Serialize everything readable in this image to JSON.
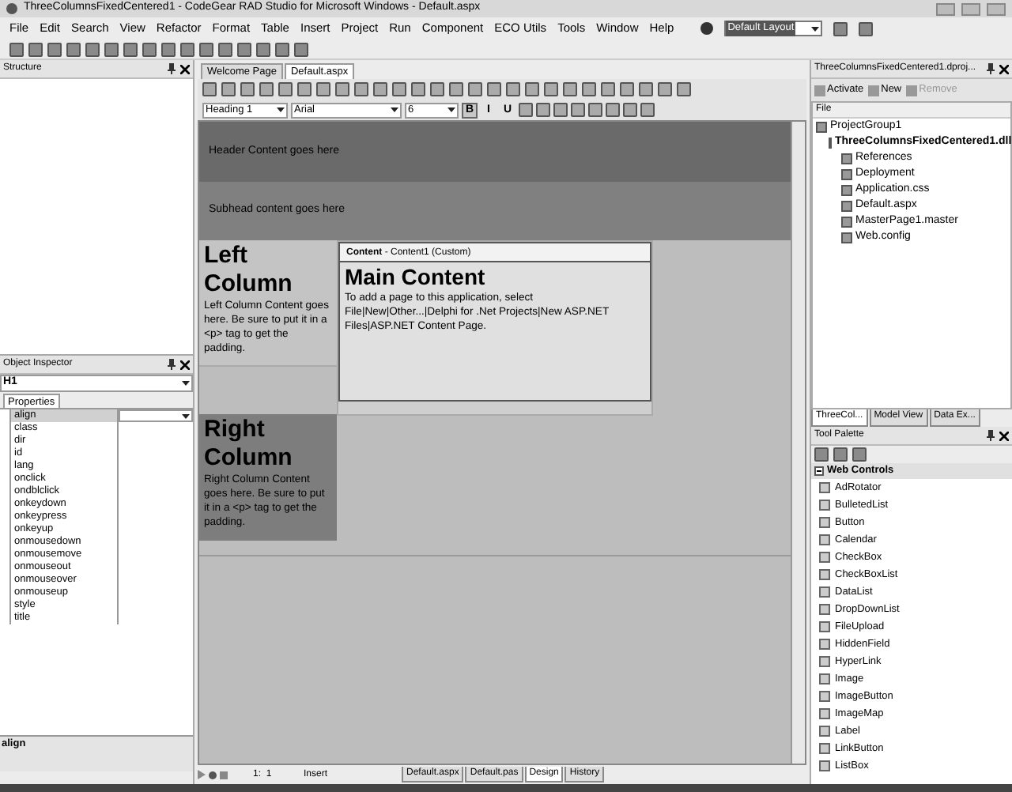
{
  "window": {
    "title": "ThreeColumnsFixedCentered1 - CodeGear RAD Studio for Microsoft Windows - Default.aspx"
  },
  "menu": [
    "File",
    "Edit",
    "Search",
    "View",
    "Refactor",
    "Format",
    "Table",
    "Insert",
    "Project",
    "Run",
    "Component",
    "ECO Utils",
    "Tools",
    "Window",
    "Help"
  ],
  "layout_selector": {
    "value": "Default Layout"
  },
  "structure": {
    "title": "Structure"
  },
  "object_inspector": {
    "title": "Object Inspector",
    "selector": "H1",
    "tabs": [
      {
        "label": "Properties",
        "selected": true
      }
    ],
    "properties": [
      {
        "name": "align",
        "selected": true
      },
      {
        "name": "class",
        "selected": false
      },
      {
        "name": "dir",
        "selected": false
      },
      {
        "name": "id",
        "selected": false
      },
      {
        "name": "lang",
        "selected": false
      },
      {
        "name": "onclick",
        "selected": false
      },
      {
        "name": "ondblclick",
        "selected": false
      },
      {
        "name": "onkeydown",
        "selected": false
      },
      {
        "name": "onkeypress",
        "selected": false
      },
      {
        "name": "onkeyup",
        "selected": false
      },
      {
        "name": "onmousedown",
        "selected": false
      },
      {
        "name": "onmousemove",
        "selected": false
      },
      {
        "name": "onmouseout",
        "selected": false
      },
      {
        "name": "onmouseover",
        "selected": false
      },
      {
        "name": "onmouseup",
        "selected": false
      },
      {
        "name": "style",
        "selected": false
      },
      {
        "name": "title",
        "selected": false
      }
    ],
    "description": "align"
  },
  "editor": {
    "tabs": [
      {
        "label": "Welcome Page",
        "selected": false
      },
      {
        "label": "Default.aspx",
        "selected": true
      }
    ],
    "block_format": "Heading 1",
    "font": "Arial",
    "size": "6",
    "styles": [
      {
        "label": "B",
        "pressed": true
      },
      {
        "label": "I",
        "pressed": false
      },
      {
        "label": "U",
        "pressed": false
      }
    ],
    "design": {
      "header": "Header Content goes here",
      "subhead": "Subhead content goes here",
      "left_column": {
        "heading": "Left Column",
        "text": "Left Column Content goes here. Be sure to put it in a <p> tag to get the padding."
      },
      "content": {
        "label": "Content",
        "caption": " - Content1 (Custom)",
        "heading": "Main Content",
        "text": "To add a page to this application, select File|New|Other...|Delphi for .Net Projects|New ASP.NET Files|ASP.NET Content Page."
      },
      "right_column": {
        "heading": "Right Column",
        "text": "Right Column Content goes here. Be sure to put it in a <p> tag to get the padding."
      }
    },
    "status": {
      "position": "1:  1",
      "mode": "Insert"
    },
    "view_tabs": [
      {
        "label": "Default.aspx",
        "selected": false
      },
      {
        "label": "Default.pas",
        "selected": false
      },
      {
        "label": "Design",
        "selected": true
      },
      {
        "label": "History",
        "selected": false
      }
    ]
  },
  "project_manager": {
    "title": "ThreeColumnsFixedCentered1.dproj...",
    "buttons": [
      {
        "label": "Activate",
        "disabled": false
      },
      {
        "label": "New",
        "disabled": false
      },
      {
        "label": "Remove",
        "disabled": true
      }
    ],
    "column": "File",
    "tree": [
      {
        "label": "ProjectGroup1",
        "bold": false,
        "children": [
          {
            "label": "ThreeColumnsFixedCentered1.dll",
            "bold": true,
            "children": [
              {
                "label": "References",
                "bold": false
              },
              {
                "label": "Deployment",
                "bold": false
              },
              {
                "label": "Application.css",
                "bold": false
              },
              {
                "label": "Default.aspx",
                "bold": false
              },
              {
                "label": "MasterPage1.master",
                "bold": false
              },
              {
                "label": "Web.config",
                "bold": false
              }
            ]
          }
        ]
      }
    ],
    "tabs": [
      {
        "label": "ThreeCol...",
        "selected": true
      },
      {
        "label": "Model View",
        "selected": false
      },
      {
        "label": "Data Ex...",
        "selected": false
      }
    ]
  },
  "tool_palette": {
    "title": "Tool Palette",
    "category": "Web Controls",
    "items": [
      "AdRotator",
      "BulletedList",
      "Button",
      "Calendar",
      "CheckBox",
      "CheckBoxList",
      "DataList",
      "DropDownList",
      "FileUpload",
      "HiddenField",
      "HyperLink",
      "Image",
      "ImageButton",
      "ImageMap",
      "Label",
      "LinkButton",
      "ListBox"
    ]
  }
}
